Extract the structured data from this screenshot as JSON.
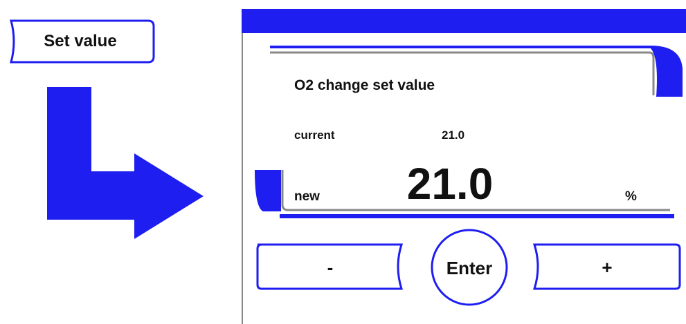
{
  "left_panel": {
    "button_label": "Set value",
    "arrow_icon": "down-right-arrow-icon"
  },
  "screen": {
    "title": "O2 change set value",
    "current_label": "current",
    "current_value": "21.0",
    "new_label": "new",
    "new_value": "21.0",
    "unit": "%",
    "minus_label": "-",
    "enter_label": "Enter",
    "plus_label": "+"
  },
  "colors": {
    "accent": "#1e1ef0",
    "frame_gray": "#888888"
  }
}
